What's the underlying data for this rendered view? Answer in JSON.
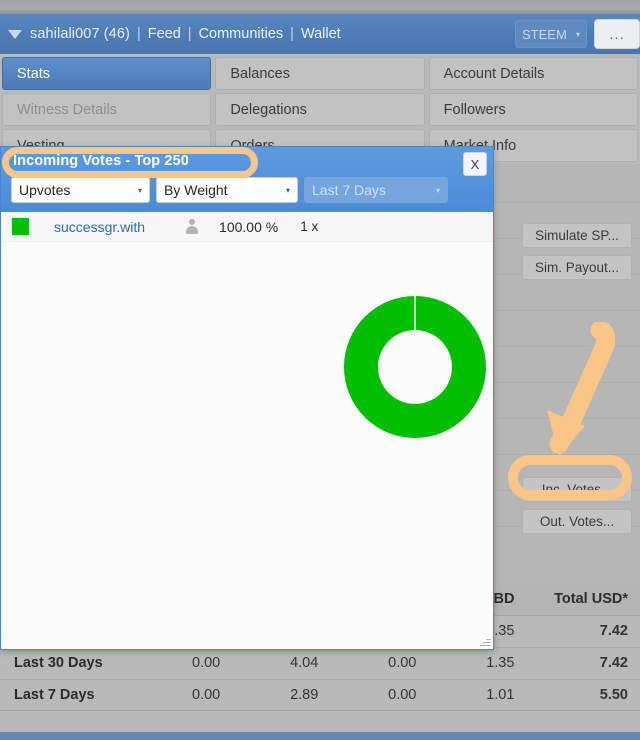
{
  "navbar": {
    "caret_icon": "chevron-down-icon",
    "username": "sahilali007 (46)",
    "separator": "|",
    "links": [
      "Feed",
      "Communities",
      "Wallet"
    ],
    "currency_select": "STEEM",
    "overflow_button": "..."
  },
  "tabs": [
    [
      "Stats",
      "Balances",
      "Account Details"
    ],
    [
      "Witness Details",
      "Delegations",
      "Followers"
    ],
    [
      "Vesting",
      "Orders",
      "Market Info"
    ]
  ],
  "active_tab": "Stats",
  "disabled_tab": "Witness Details",
  "side_buttons": [
    "Simulate SP...",
    "Sim. Payout...",
    "Inc. Votes...",
    "Out. Votes..."
  ],
  "modal": {
    "title": "Incoming Votes - Top 250",
    "close_label": "X",
    "filters": {
      "vote_type": "Upvotes",
      "sort_by": "By Weight",
      "period": "Last 7 Days"
    },
    "rows": [
      {
        "color": "#00c000",
        "name": "successgr.with",
        "person_icon": "person-icon",
        "percent": "100.00 %",
        "count": "1 x"
      }
    ]
  },
  "chart_data": {
    "type": "pie",
    "title": "Incoming Votes - Top 250",
    "subtype": "donut",
    "categories": [
      "successgr.with"
    ],
    "values": [
      100.0
    ],
    "colors": [
      "#00c000"
    ],
    "unit": "%",
    "legend": "inline-list",
    "total": 100.0,
    "inner_radius_ratio": 0.52
  },
  "table": {
    "headers": [
      "",
      "",
      "",
      "",
      "BD",
      "Total USD*"
    ],
    "rows": [
      {
        "label": "",
        "cells": [
          "",
          "",
          "",
          ".35"
        ],
        "total": "7.42"
      },
      {
        "label": "Last 30 Days",
        "cells": [
          "0.00",
          "4.04",
          "0.00",
          "1.35"
        ],
        "total": "7.42"
      },
      {
        "label": "Last 7 Days",
        "cells": [
          "0.00",
          "2.89",
          "0.00",
          "1.01"
        ],
        "total": "5.50"
      }
    ]
  },
  "annotations": {
    "highlight_color": "#fac585",
    "title_highlight": "Incoming Votes - Top 250",
    "button_highlight": "Inc. Votes...",
    "arrow": "down-left-arrow"
  }
}
